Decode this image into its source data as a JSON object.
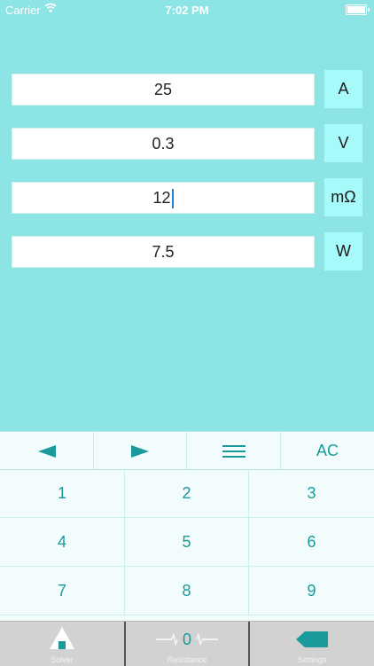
{
  "status": {
    "carrier": "Carrier",
    "time": "7:02 PM"
  },
  "rows": [
    {
      "value": "25",
      "unit": "A"
    },
    {
      "value": "0.3",
      "unit": "V"
    },
    {
      "value": "12",
      "unit": "mΩ"
    },
    {
      "value": "7.5",
      "unit": "W"
    }
  ],
  "keypad": {
    "nav": {
      "left_icon": "left-triangle-icon",
      "right_icon": "right-triangle-icon",
      "menu_icon": "menu-icon",
      "clear_label": "AC"
    },
    "keys": [
      "1",
      "2",
      "3",
      "4",
      "5",
      "6",
      "7",
      "8",
      "9"
    ]
  },
  "tabs": [
    {
      "label": "Solver",
      "icon": "house-icon"
    },
    {
      "label": "Resistance",
      "value": "0",
      "icon": "resistor-icon"
    },
    {
      "label": "Settings",
      "icon": "tag-icon"
    }
  ],
  "colors": {
    "background": "#8ce4e4",
    "unit_button": "#a6fafa",
    "accent": "#1a9a9a",
    "caret": "#1a7fd6"
  }
}
